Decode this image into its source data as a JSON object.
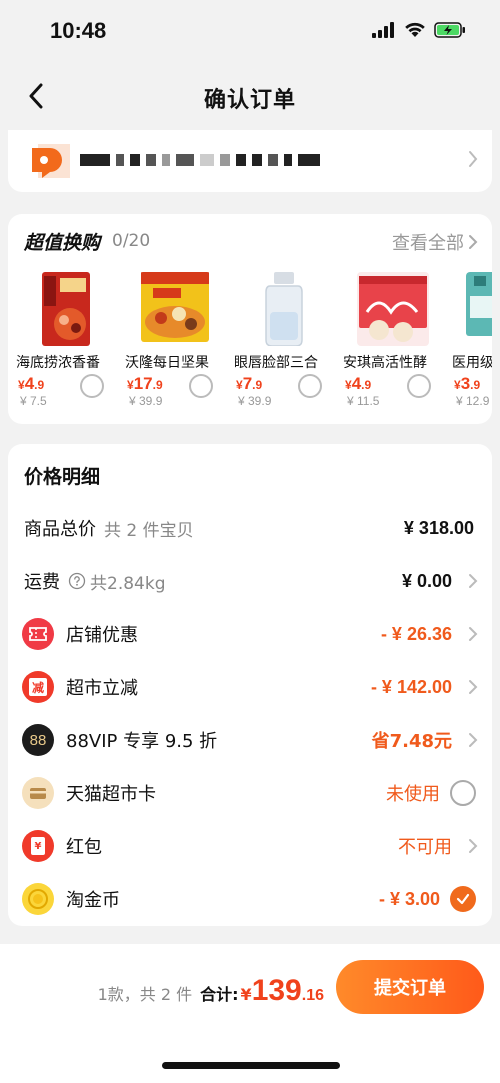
{
  "status_bar": {
    "time": "10:48"
  },
  "nav": {
    "title": "确认订单"
  },
  "deals": {
    "title": "超值换购",
    "count": "0/20",
    "see_all": "查看全部",
    "items": [
      {
        "name": "海底捞浓香番",
        "price": "4",
        "price_dec": ".9",
        "orig": "¥ 7.5"
      },
      {
        "name": "沃隆每日坚果",
        "price": "17",
        "price_dec": ".9",
        "orig": "¥ 39.9"
      },
      {
        "name": "眼唇脸部三合",
        "price": "7",
        "price_dec": ".9",
        "orig": "¥ 39.9"
      },
      {
        "name": "安琪高活性酵",
        "price": "4",
        "price_dec": ".9",
        "orig": "¥ 11.5"
      },
      {
        "name": "医用级",
        "price": "3",
        "price_dec": ".9",
        "orig": "¥ 12.9"
      }
    ],
    "currency": "¥"
  },
  "price_detail": {
    "title": "价格明细",
    "goods_total": {
      "label": "商品总价",
      "sub": "共 2 件宝贝",
      "value": "¥ 318.00"
    },
    "shipping": {
      "label": "运费",
      "sub": "共2.84kg",
      "value": "¥ 0.00"
    },
    "store_discount": {
      "label": "店铺优惠",
      "value": "- ¥ 26.36"
    },
    "market_discount": {
      "label": "超市立减",
      "value": "- ¥ 142.00",
      "icon_text": "减"
    },
    "vip": {
      "label": "88VIP 专享 9.5 折",
      "value": "省7.48元",
      "icon_text": "88"
    },
    "tmall_card": {
      "label": "天猫超市卡",
      "value": "未使用"
    },
    "red_packet": {
      "label": "红包",
      "value": "不可用",
      "icon_text": "¥"
    },
    "taojin": {
      "label": "淘金币",
      "value": "- ¥ 3.00"
    }
  },
  "bottom": {
    "count": "1款，共 2 件",
    "total_label": "合计:",
    "yen": "¥",
    "amount": "139",
    "cents": ".16",
    "submit": "提交订单"
  },
  "colors": {
    "accent": "#f05a1c",
    "price_red": "#f0421c"
  }
}
